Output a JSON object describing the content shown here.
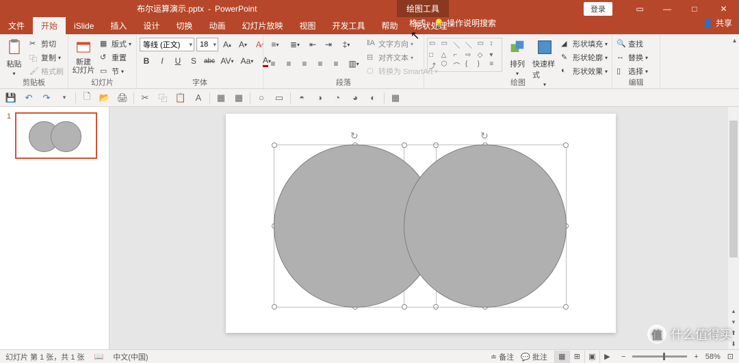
{
  "title": {
    "filename": "布尔运算演示.pptx",
    "separator": "-",
    "app": "PowerPoint"
  },
  "contextTab": "绘图工具",
  "login": "登录",
  "tabs": {
    "file": "文件",
    "home": "开始",
    "islide": "iSlide",
    "insert": "插入",
    "design": "设计",
    "transitions": "切换",
    "animations": "动画",
    "slideshow": "幻灯片放映",
    "view": "视图",
    "developer": "开发工具",
    "help": "帮助",
    "shapeproc": "形状处理",
    "format": "格式"
  },
  "tellme": "操作说明搜索",
  "share": "共享",
  "clipboard": {
    "label": "剪贴板",
    "paste": "粘贴",
    "cut": "剪切",
    "copy": "复制",
    "formatPainter": "格式刷"
  },
  "slides": {
    "label": "幻灯片",
    "newSlide": "新建\n幻灯片",
    "layout": "版式",
    "reset": "重置",
    "section": "节"
  },
  "font": {
    "label": "字体",
    "name": "等线 (正文)",
    "size": "18",
    "bold": "B",
    "italic": "I",
    "underline": "U",
    "shadow": "S",
    "strike": "abc",
    "spacing": "AV",
    "case": "Aa"
  },
  "paragraph": {
    "label": "段落",
    "textDir": "文字方向",
    "alignText": "对齐文本",
    "smartArt": "转换为 SmartArt"
  },
  "drawing": {
    "label": "绘图",
    "arrange": "排列",
    "quickStyle": "快速样式",
    "shapeFill": "形状填充",
    "shapeOutline": "形状轮廓",
    "shapeEffects": "形状效果"
  },
  "editing": {
    "label": "编辑",
    "find": "查找",
    "replace": "替换",
    "select": "选择"
  },
  "status": {
    "slideInfo": "幻灯片 第 1 张，共 1 张",
    "lang": "中文(中国)",
    "notes": "备注",
    "comments": "批注",
    "zoom": "58%"
  },
  "thumbNum": "1",
  "watermark": "什么值得买"
}
